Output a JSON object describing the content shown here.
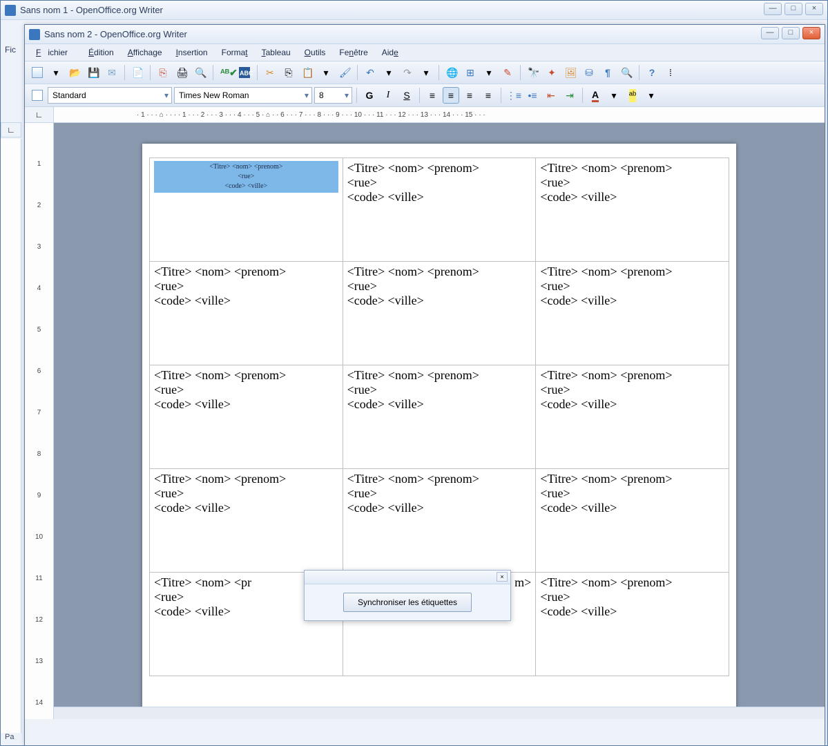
{
  "parent_window": {
    "title": "Sans nom 1 - OpenOffice.org Writer",
    "menu_fragment": "Fic",
    "status_fragment": "Pa"
  },
  "window": {
    "title": "Sans nom 2 - OpenOffice.org Writer"
  },
  "menu": {
    "file": "Fichier",
    "edit": "Édition",
    "view": "Affichage",
    "insert": "Insertion",
    "format": "Format",
    "table": "Tableau",
    "tools": "Outils",
    "window": "Fenêtre",
    "help": "Aide"
  },
  "format_bar": {
    "style": "Standard",
    "font": "Times New Roman",
    "size": "8"
  },
  "ruler_text": "· 1 · · · ⌂ · · · · 1 · · · 2 · · · 3 · · · 4 · · · 5 · ⌂ · · 6 · · · 7 · · · 8 · · · 9 · · · 10 · · · 11 · · · 12 · · · 13 · · · 14 · · · 15 · · ·",
  "vruler_ticks": [
    "1",
    "2",
    "3",
    "4",
    "5",
    "6",
    "7",
    "8",
    "9",
    "10",
    "11",
    "12",
    "13",
    "14"
  ],
  "label": {
    "line1": "<Titre> <nom> <prenom>",
    "line2": "<rue>",
    "line3": "<code> <ville>"
  },
  "label_sel": {
    "line1": "<Titre> <nom> <prenom>",
    "line2": "<rue>",
    "line3": "<code> <ville>"
  },
  "label_partial": {
    "left_line1": "<Titre> <nom> <pr",
    "mid_line1": "m>"
  },
  "dialog": {
    "button": "Synchroniser les étiquettes",
    "close": "×"
  },
  "win_controls": {
    "min": "—",
    "max": "□",
    "close": "×"
  }
}
